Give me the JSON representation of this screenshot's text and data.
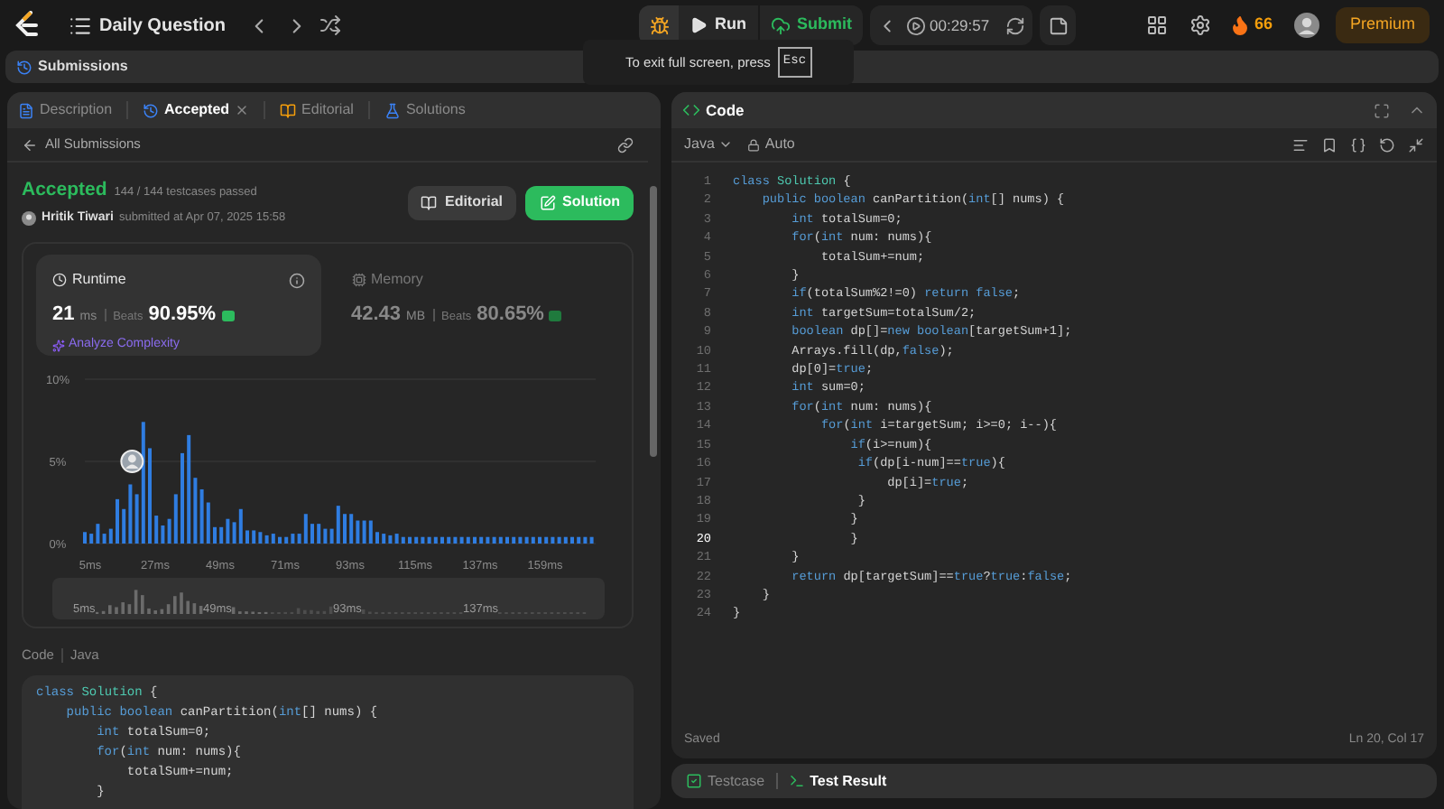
{
  "top_bar": {
    "title": "Daily Question",
    "run_label": "Run",
    "submit_label": "Submit",
    "timer": "00:29:57",
    "streak": "66",
    "premium_label": "Premium"
  },
  "fullscreen_hint": {
    "text": "To exit full screen, press",
    "key": "Esc"
  },
  "submissions_bar": {
    "title": "Submissions"
  },
  "left_panel": {
    "tabs": [
      {
        "label": "Description",
        "kind": "description",
        "selected": false,
        "closable": false
      },
      {
        "label": "Accepted",
        "kind": "submission",
        "selected": true,
        "closable": true
      },
      {
        "label": "Editorial",
        "kind": "editorial",
        "selected": false,
        "closable": false
      },
      {
        "label": "Solutions",
        "kind": "solutions",
        "selected": false,
        "closable": false
      }
    ],
    "back_link": "All Submissions",
    "status": "Accepted",
    "testcases": "144 / 144 testcases passed",
    "author": "Hritik Tiwari",
    "submitted": "submitted at Apr 07, 2025 15:58",
    "buttons": [
      {
        "label": "Editorial",
        "kind": "secondary"
      },
      {
        "label": "Solution",
        "kind": "primary"
      }
    ],
    "metrics": [
      {
        "kind": "runtime",
        "title": "Runtime",
        "value": "21",
        "unit": "ms",
        "beats_label": "Beats",
        "beats": "90.95%",
        "selected": true,
        "action": "Analyze Complexity"
      },
      {
        "kind": "memory",
        "title": "Memory",
        "value": "42.43",
        "unit": "MB",
        "beats_label": "Beats",
        "beats": "80.65%",
        "selected": false
      }
    ],
    "chart_data": {
      "type": "bar",
      "xlim": [
        5,
        178
      ],
      "ylim": [
        0,
        10
      ],
      "xticks": [
        {
          "value": 5,
          "label": "5ms"
        },
        {
          "value": 27,
          "label": "27ms"
        },
        {
          "value": 49,
          "label": "49ms"
        },
        {
          "value": 71,
          "label": "71ms"
        },
        {
          "value": 93,
          "label": "93ms"
        },
        {
          "value": 115,
          "label": "115ms"
        },
        {
          "value": 137,
          "label": "137ms"
        },
        {
          "value": 159,
          "label": "159ms"
        }
      ],
      "yticks": [
        {
          "value": 0,
          "label": "0%"
        },
        {
          "value": 5,
          "label": "5%"
        },
        {
          "value": 10,
          "label": "10%"
        }
      ],
      "x": [
        5,
        7.2,
        9.4,
        11.6,
        13.8,
        16,
        18.2,
        20.4,
        22.6,
        24.8,
        27,
        29.2,
        31.4,
        33.6,
        35.8,
        38,
        40.2,
        42.4,
        44.6,
        46.8,
        49,
        51.2,
        53.4,
        55.6,
        57.8,
        60,
        62.2,
        64.4,
        66.6,
        68.8,
        71,
        73.2,
        75.4,
        77.6,
        79.8,
        82,
        84.2,
        86.4,
        88.6,
        90.8,
        93,
        95.2,
        97.4,
        99.6,
        101.8,
        104,
        106.2,
        108.4,
        110.6,
        112.8,
        115,
        117.2,
        119.4,
        121.6,
        123.8,
        126,
        128.2,
        130.4,
        132.6,
        134.8,
        137,
        139.2,
        141.4,
        143.6,
        145.8,
        148,
        150.2,
        152.4,
        154.6,
        156.8,
        159,
        161.2,
        163.4,
        165.6,
        167.8,
        170,
        172.2,
        174.4,
        176.6
      ],
      "series": [
        {
          "color": "#2f7de1",
          "values": [
            0.7,
            0.6,
            1.2,
            0.6,
            0.9,
            2.7,
            2.1,
            3.6,
            3.0,
            7.4,
            5.8,
            1.7,
            1.1,
            1.5,
            3.0,
            5.5,
            6.6,
            4.0,
            3.3,
            2.5,
            1.0,
            1.0,
            1.5,
            1.3,
            2.1,
            0.8,
            0.8,
            0.7,
            0.5,
            0.6,
            0.4,
            0.4,
            0.6,
            0.6,
            1.8,
            1.2,
            1.2,
            0.9,
            0.9,
            2.3,
            1.8,
            1.8,
            1.4,
            1.4,
            1.4,
            0.7,
            0.6,
            0.5,
            0.6,
            0.4,
            0.4,
            0.4,
            0.4,
            0.4,
            0.4,
            0.4,
            0.4,
            0.4,
            0.4,
            0.4,
            0.4,
            0.4,
            0.4,
            0.4,
            0.4,
            0.4,
            0.4,
            0.4,
            0.4,
            0.4,
            0.4,
            0.4,
            0.4,
            0.4,
            0.4,
            0.4,
            0.4,
            0.4,
            0.4
          ]
        }
      ]
    },
    "overview_labels": [
      "5ms",
      "49ms",
      "93ms",
      "137ms"
    ],
    "code_header": {
      "title": "Code",
      "language": "Java"
    },
    "code_lines": [
      [
        {
          "kind": "keyword",
          "text": "class "
        },
        {
          "kind": "type",
          "text": "Solution"
        },
        {
          "kind": "plain",
          "text": " {"
        }
      ],
      [
        {
          "kind": "keyword",
          "text": "    public boolean "
        },
        {
          "kind": "plain",
          "text": "canPartition("
        },
        {
          "kind": "keyword",
          "text": "int"
        },
        {
          "kind": "plain",
          "text": "[] nums) {"
        }
      ],
      [
        {
          "kind": "keyword",
          "text": "        int "
        },
        {
          "kind": "plain",
          "text": "totalSum=0;"
        }
      ],
      [
        {
          "kind": "keyword",
          "text": "        for"
        },
        {
          "kind": "plain",
          "text": "("
        },
        {
          "kind": "keyword",
          "text": "int "
        },
        {
          "kind": "plain",
          "text": "num: nums){"
        }
      ],
      [
        {
          "kind": "plain",
          "text": "            totalSum+=num;"
        }
      ],
      [
        {
          "kind": "plain",
          "text": "        }"
        }
      ]
    ]
  },
  "editor": {
    "title": "Code",
    "language": "Java",
    "mode": "Auto",
    "status": "Saved",
    "cursor": "Ln 20, Col 17",
    "lines": [
      {
        "number": "1",
        "current": false,
        "tokens": [
          {
            "kind": "keyword",
            "text": "class "
          },
          {
            "kind": "type",
            "text": "Solution"
          },
          {
            "kind": "plain",
            "text": " {"
          }
        ]
      },
      {
        "number": "2",
        "current": false,
        "tokens": [
          {
            "kind": "keyword",
            "text": "    public boolean "
          },
          {
            "kind": "plain",
            "text": "canPartition("
          },
          {
            "kind": "keyword",
            "text": "int"
          },
          {
            "kind": "plain",
            "text": "[] nums) {"
          }
        ]
      },
      {
        "number": "3",
        "current": false,
        "tokens": [
          {
            "kind": "keyword",
            "text": "        int "
          },
          {
            "kind": "plain",
            "text": "totalSum=0;"
          }
        ]
      },
      {
        "number": "4",
        "current": false,
        "tokens": [
          {
            "kind": "keyword",
            "text": "        for"
          },
          {
            "kind": "plain",
            "text": "("
          },
          {
            "kind": "keyword",
            "text": "int "
          },
          {
            "kind": "plain",
            "text": "num: nums){"
          }
        ]
      },
      {
        "number": "5",
        "current": false,
        "tokens": [
          {
            "kind": "plain",
            "text": "            totalSum+=num;"
          }
        ]
      },
      {
        "number": "6",
        "current": false,
        "tokens": [
          {
            "kind": "plain",
            "text": "        }"
          }
        ]
      },
      {
        "number": "7",
        "current": false,
        "tokens": [
          {
            "kind": "keyword",
            "text": "        if"
          },
          {
            "kind": "plain",
            "text": "(totalSum%2!=0) "
          },
          {
            "kind": "keyword",
            "text": "return false"
          },
          {
            "kind": "plain",
            "text": ";"
          }
        ]
      },
      {
        "number": "8",
        "current": false,
        "tokens": [
          {
            "kind": "keyword",
            "text": "        int "
          },
          {
            "kind": "plain",
            "text": "targetSum=totalSum/2;"
          }
        ]
      },
      {
        "number": "9",
        "current": false,
        "tokens": [
          {
            "kind": "keyword",
            "text": "        boolean "
          },
          {
            "kind": "plain",
            "text": "dp[]="
          },
          {
            "kind": "keyword",
            "text": "new boolean"
          },
          {
            "kind": "plain",
            "text": "[targetSum+1];"
          }
        ]
      },
      {
        "number": "10",
        "current": false,
        "tokens": [
          {
            "kind": "plain",
            "text": "        Arrays.fill(dp,"
          },
          {
            "kind": "keyword",
            "text": "false"
          },
          {
            "kind": "plain",
            "text": ");"
          }
        ]
      },
      {
        "number": "11",
        "current": false,
        "tokens": [
          {
            "kind": "plain",
            "text": "        dp[0]="
          },
          {
            "kind": "keyword",
            "text": "true"
          },
          {
            "kind": "plain",
            "text": ";"
          }
        ]
      },
      {
        "number": "12",
        "current": false,
        "tokens": [
          {
            "kind": "keyword",
            "text": "        int "
          },
          {
            "kind": "plain",
            "text": "sum=0;"
          }
        ]
      },
      {
        "number": "13",
        "current": false,
        "tokens": [
          {
            "kind": "keyword",
            "text": "        for"
          },
          {
            "kind": "plain",
            "text": "("
          },
          {
            "kind": "keyword",
            "text": "int "
          },
          {
            "kind": "plain",
            "text": "num: nums){"
          }
        ]
      },
      {
        "number": "14",
        "current": false,
        "tokens": [
          {
            "kind": "keyword",
            "text": "            for"
          },
          {
            "kind": "plain",
            "text": "("
          },
          {
            "kind": "keyword",
            "text": "int "
          },
          {
            "kind": "plain",
            "text": "i=targetSum; i>=0; i--){"
          }
        ]
      },
      {
        "number": "15",
        "current": false,
        "tokens": [
          {
            "kind": "keyword",
            "text": "                if"
          },
          {
            "kind": "plain",
            "text": "(i>=num){"
          }
        ]
      },
      {
        "number": "16",
        "current": false,
        "tokens": [
          {
            "kind": "keyword",
            "text": "                 if"
          },
          {
            "kind": "plain",
            "text": "(dp[i-num]=="
          },
          {
            "kind": "keyword",
            "text": "true"
          },
          {
            "kind": "plain",
            "text": "){"
          }
        ]
      },
      {
        "number": "17",
        "current": false,
        "tokens": [
          {
            "kind": "plain",
            "text": "                     dp[i]="
          },
          {
            "kind": "keyword",
            "text": "true"
          },
          {
            "kind": "plain",
            "text": ";"
          }
        ]
      },
      {
        "number": "18",
        "current": false,
        "tokens": [
          {
            "kind": "plain",
            "text": "                 }"
          }
        ]
      },
      {
        "number": "19",
        "current": false,
        "tokens": [
          {
            "kind": "plain",
            "text": "                }"
          }
        ]
      },
      {
        "number": "20",
        "current": true,
        "tokens": [
          {
            "kind": "plain",
            "text": "                }"
          }
        ]
      },
      {
        "number": "21",
        "current": false,
        "tokens": [
          {
            "kind": "plain",
            "text": "        }"
          }
        ]
      },
      {
        "number": "22",
        "current": false,
        "tokens": [
          {
            "kind": "keyword",
            "text": "        return "
          },
          {
            "kind": "plain",
            "text": "dp[targetSum]=="
          },
          {
            "kind": "keyword",
            "text": "true"
          },
          {
            "kind": "plain",
            "text": "?"
          },
          {
            "kind": "keyword",
            "text": "true"
          },
          {
            "kind": "plain",
            "text": ":"
          },
          {
            "kind": "keyword",
            "text": "false"
          },
          {
            "kind": "plain",
            "text": ";"
          }
        ]
      },
      {
        "number": "23",
        "current": false,
        "tokens": [
          {
            "kind": "plain",
            "text": "    }"
          }
        ]
      },
      {
        "number": "24",
        "current": false,
        "tokens": [
          {
            "kind": "plain",
            "text": "}"
          }
        ]
      }
    ]
  },
  "bottom_tabs": [
    {
      "label": "Testcase",
      "kind": "testcase",
      "selected": false
    },
    {
      "label": "Test Result",
      "kind": "result",
      "selected": true
    }
  ]
}
